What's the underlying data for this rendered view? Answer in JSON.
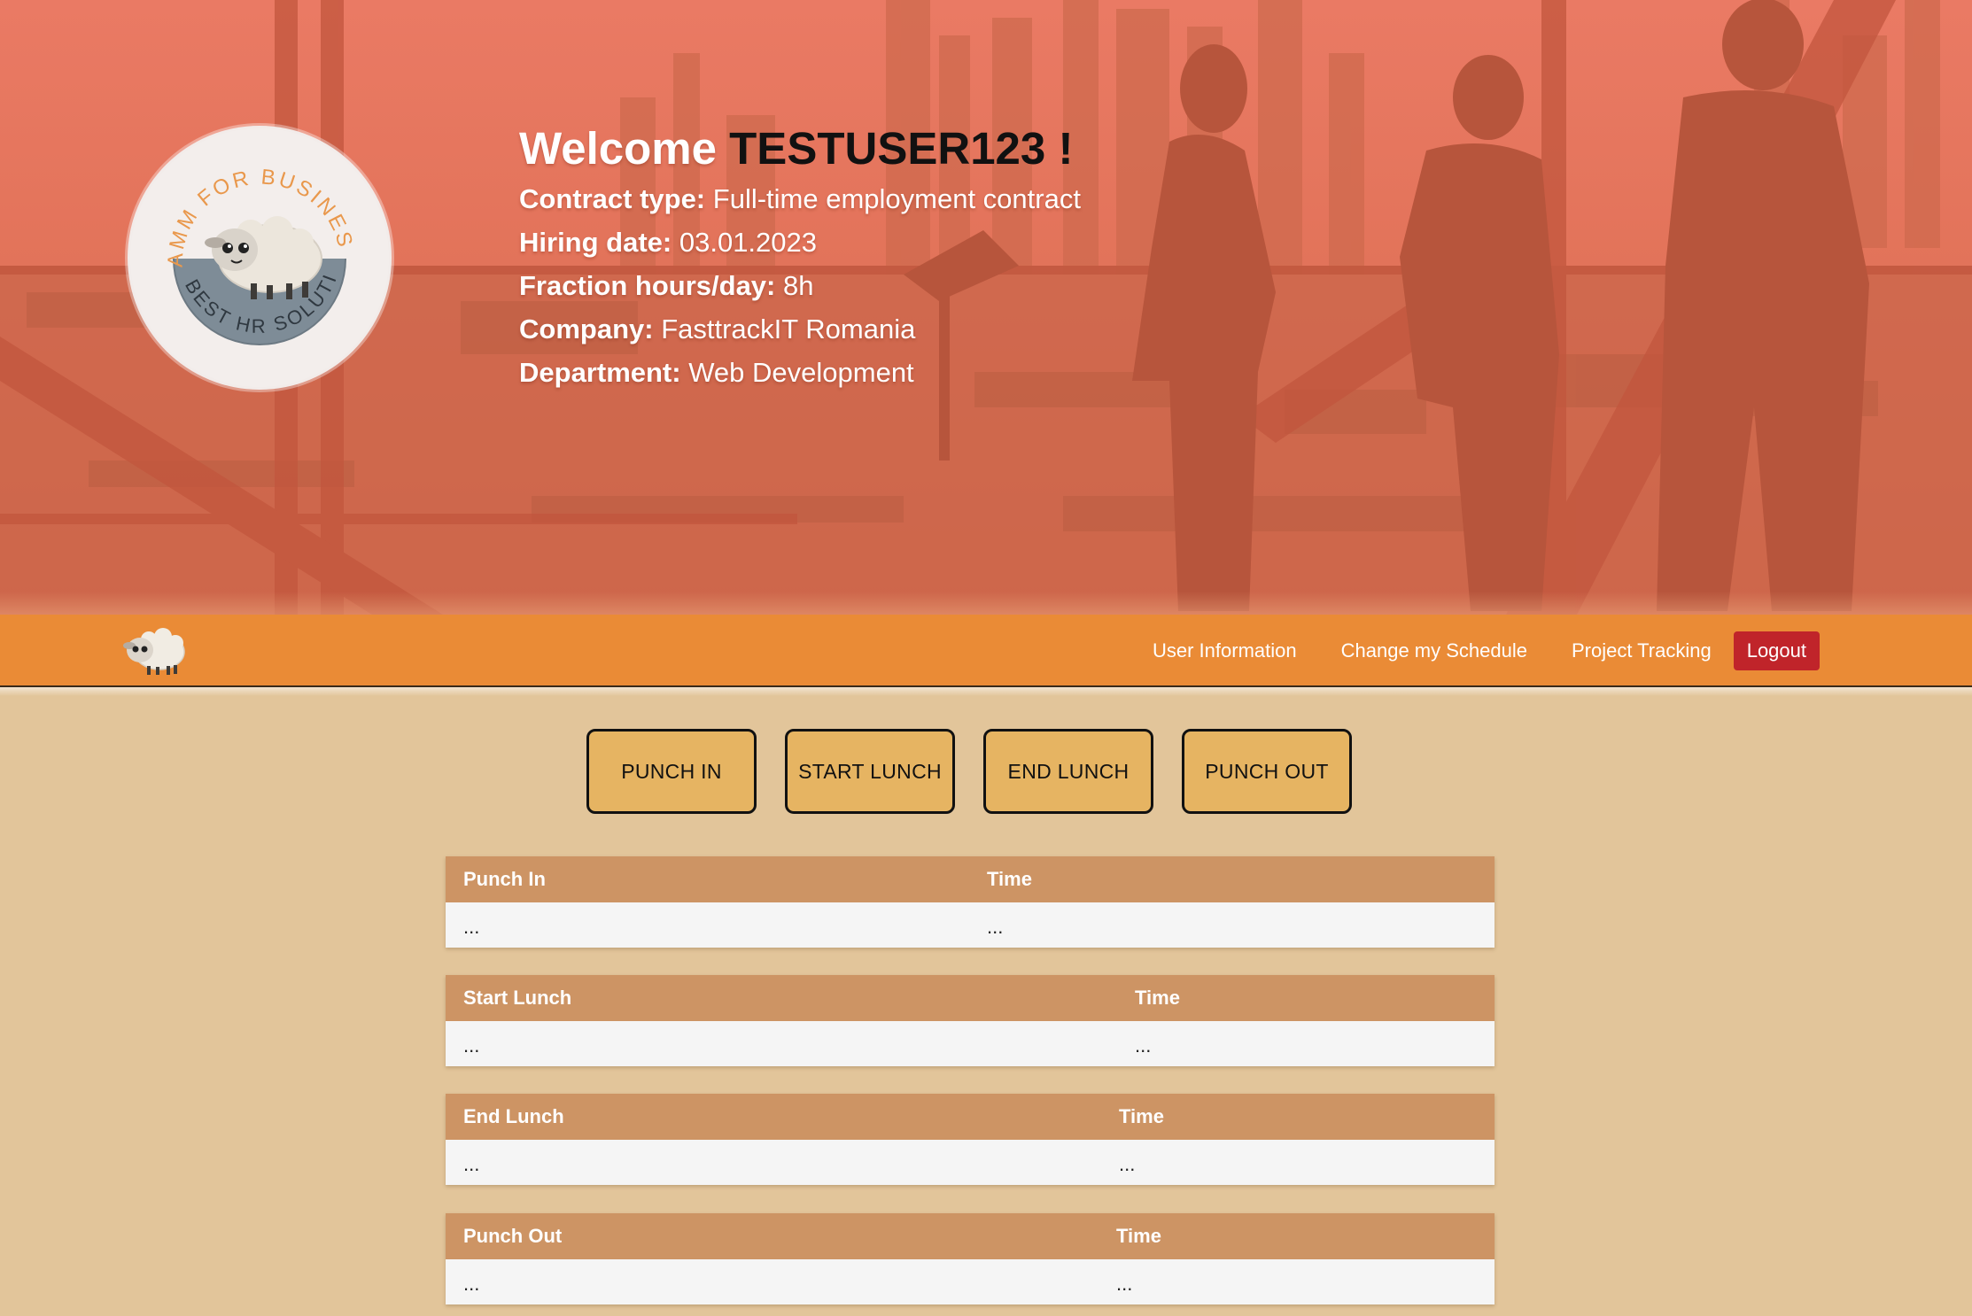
{
  "colors": {
    "hero_tint": "#e87461",
    "navbar": "#ea8b36",
    "page_background": "#e2c59a",
    "logout": "#c0242a",
    "action_button": "#e6b462",
    "table_header": "#cd9464",
    "table_body": "#f5f5f5"
  },
  "hero": {
    "badge": {
      "arc_top_text": "AMM FOR BUSINESSES",
      "arc_bottom_text": "BEST HR SOLUTION",
      "icon": "sheep-icon"
    },
    "welcome_prefix": "Welcome",
    "username": "TESTUSER123 !",
    "info": [
      {
        "label": "Contract type:",
        "value": "Full-time employment contract"
      },
      {
        "label": "Hiring date:",
        "value": "03.01.2023"
      },
      {
        "label": "Fraction hours/day:",
        "value": "8h"
      },
      {
        "label": "Company:",
        "value": "FasttrackIT Romania"
      },
      {
        "label": "Department:",
        "value": "Web Development"
      }
    ]
  },
  "navbar": {
    "logo_icon": "sheep-icon",
    "links": [
      "User Information",
      "Change my Schedule",
      "Project Tracking"
    ],
    "logout_label": "Logout"
  },
  "actions": [
    "PUNCH IN",
    "START LUNCH",
    "END LUNCH",
    "PUNCH OUT"
  ],
  "tables": [
    {
      "header": "Punch In",
      "time_header": "Time",
      "value": "...",
      "time_value": "..."
    },
    {
      "header": "Start Lunch",
      "time_header": "Time",
      "value": "...",
      "time_value": "..."
    },
    {
      "header": "End Lunch",
      "time_header": "Time",
      "value": "...",
      "time_value": "..."
    },
    {
      "header": "Punch Out",
      "time_header": "Time",
      "value": "...",
      "time_value": "..."
    }
  ]
}
